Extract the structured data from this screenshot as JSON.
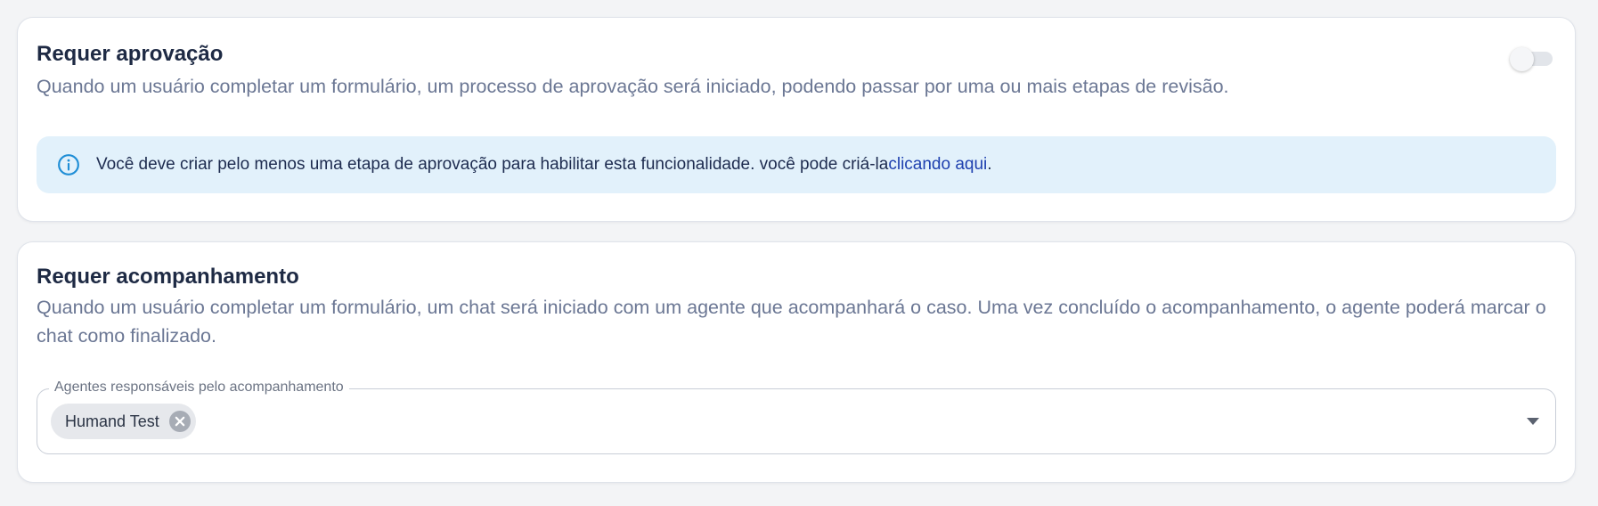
{
  "approval": {
    "title": "Requer aprovação",
    "description": "Quando um usuário completar um formulário, um processo de aprovação será iniciado, podendo passar por uma ou mais etapas de revisão.",
    "toggle_on": false,
    "info": {
      "icon": "info-icon",
      "text": "Você deve criar pelo menos uma etapa de aprovação para habilitar esta funcionalidade. você pode criá-la",
      "link": "clicando aqui",
      "suffix": "."
    }
  },
  "followup": {
    "title": "Requer acompanhamento",
    "description": "Quando um usuário completar um formulário, um chat será iniciado com um agente que acompanhará o caso. Uma vez concluído o acompanhamento, o agente poderá marcar o chat como finalizado.",
    "agents_field": {
      "label": "Agentes responsáveis pelo acompanhamento",
      "selected": [
        "Humand Test"
      ],
      "remove_icon": "close-circle-icon",
      "dropdown_icon": "chevron-down-icon"
    }
  },
  "colors": {
    "page_bg": "#f3f4f6",
    "card_bg": "#ffffff",
    "title": "#1e2a44",
    "description": "#6b7794",
    "info_bg": "#e2f1fb",
    "info_icon": "#1f8ed6",
    "link": "#1e40af",
    "chip_bg": "#e6e8ec"
  }
}
